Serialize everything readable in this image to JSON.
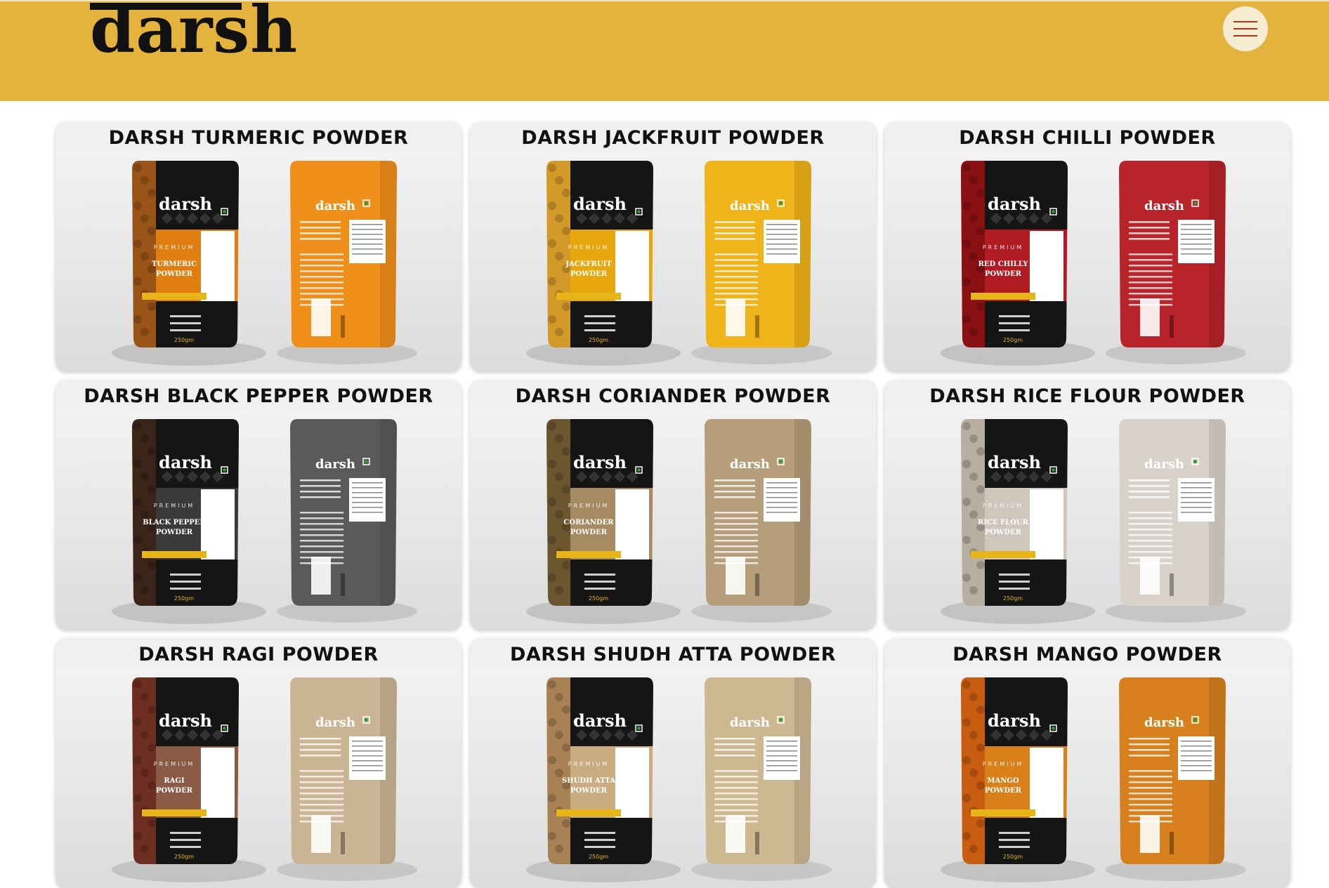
{
  "header": {
    "logo_text": "darsh",
    "background_color": "#e3b33e",
    "menu_icon": "hamburger-menu-icon"
  },
  "products": [
    {
      "title": "DARSH TURMERIC POWDER",
      "pack_name_line1": "TURMERIC",
      "pack_name_line2": "POWDER",
      "front_color": "#e07e12",
      "back_color": "#f08f1a",
      "spice_color": "#9a5418"
    },
    {
      "title": "DARSH JACKFRUIT POWDER",
      "pack_name_line1": "JACKFRUIT",
      "pack_name_line2": "POWDER",
      "front_color": "#e8a70f",
      "back_color": "#f1b31a",
      "spice_color": "#d39a2a"
    },
    {
      "title": "DARSH CHILLI POWDER",
      "pack_name_line1": "RED CHILLY",
      "pack_name_line2": "POWDER",
      "front_color": "#b01c22",
      "back_color": "#b8242a",
      "spice_color": "#8a1014"
    },
    {
      "title": "DARSH BLACK PEPPER POWDER",
      "pack_name_line1": "BLACK PEPPER",
      "pack_name_line2": "POWDER",
      "front_color": "#3a3a3a",
      "back_color": "#5a5a5a",
      "spice_color": "#3b2418"
    },
    {
      "title": "DARSH CORIANDER POWDER",
      "pack_name_line1": "CORIANDER",
      "pack_name_line2": "POWDER",
      "front_color": "#a58a62",
      "back_color": "#b79e7a",
      "spice_color": "#6b5630"
    },
    {
      "title": "DARSH RICE FLOUR POWDER",
      "pack_name_line1": "RICE FLOUR",
      "pack_name_line2": "POWDER",
      "front_color": "#cfc6bc",
      "back_color": "#d9d2ca",
      "spice_color": "#b8aea2"
    },
    {
      "title": "DARSH RAGI POWDER",
      "pack_name_line1": "RAGI",
      "pack_name_line2": "POWDER",
      "front_color": "#8a5a45",
      "back_color": "#cbb594",
      "spice_color": "#6e2f22"
    },
    {
      "title": "DARSH SHUDH ATTA POWDER",
      "pack_name_line1": "SHUDH ATTA",
      "pack_name_line2": "POWDER",
      "front_color": "#c9ad80",
      "back_color": "#cdb892",
      "spice_color": "#a88255"
    },
    {
      "title": "DARSH MANGO POWDER",
      "pack_name_line1": "MANGO",
      "pack_name_line2": "POWDER",
      "front_color": "#d9801a",
      "back_color": "#d7801d",
      "spice_color": "#c85d12"
    }
  ],
  "pack_text": {
    "brand": "darsh",
    "premium": "PREMIUM",
    "weight": "250gm"
  }
}
